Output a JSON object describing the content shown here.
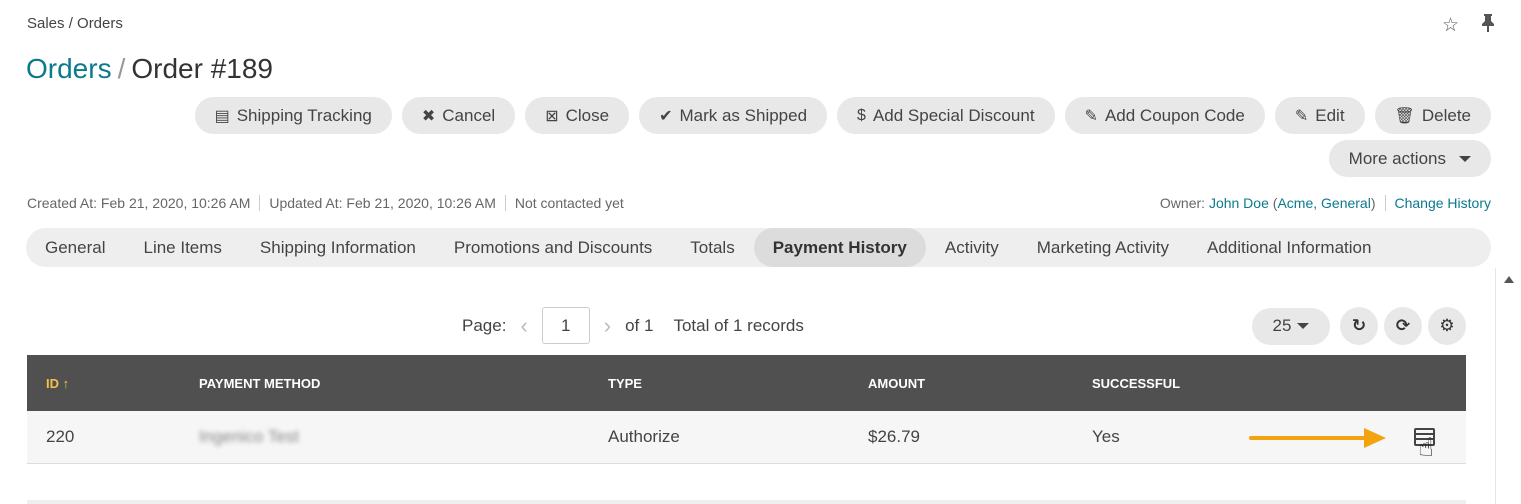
{
  "breadcrumb": "Sales / Orders",
  "top_icons": {
    "favorite_icon": "☆",
    "pin_icon": "📌"
  },
  "title": {
    "parent": "Orders",
    "separator": "/",
    "current": "Order #189"
  },
  "actions": [
    {
      "icon": "▤",
      "label": "Shipping Tracking"
    },
    {
      "icon": "✖",
      "label": "Cancel"
    },
    {
      "icon": "⊠",
      "label": "Close"
    },
    {
      "icon": "✔",
      "label": "Mark as Shipped"
    },
    {
      "icon": "$",
      "label": "Add Special Discount"
    },
    {
      "icon": "✎",
      "label": "Add Coupon Code"
    },
    {
      "icon": "✎",
      "label": "Edit"
    },
    {
      "icon": "🗑",
      "label": "Delete"
    }
  ],
  "more_actions": "More actions",
  "meta": {
    "created": "Created At: Feb 21, 2020, 10:26 AM",
    "updated": "Updated At: Feb 21, 2020, 10:26 AM",
    "contacted": "Not contacted yet"
  },
  "owner": {
    "label": "Owner:",
    "name": "John Doe",
    "paren_open": "(",
    "org": "Acme",
    "comma": ",",
    "bu": "General",
    "paren_close": ")",
    "change_history": "Change History"
  },
  "tabs": [
    "General",
    "Line Items",
    "Shipping Information",
    "Promotions and Discounts",
    "Totals",
    "Payment History",
    "Activity",
    "Marketing Activity",
    "Additional Information"
  ],
  "active_tab": "Payment History",
  "pager": {
    "label": "Page:",
    "current": "1",
    "of": "of 1",
    "total": "Total of 1 records",
    "prev_icon": "‹",
    "next_icon": "›"
  },
  "per_page": "25",
  "tool_icons": {
    "refresh": "↻",
    "reset": "⟳",
    "settings": "⚙"
  },
  "table": {
    "headers": {
      "id": "ID",
      "sort_icon": "↑",
      "payment_method": "PAYMENT METHOD",
      "type": "TYPE",
      "amount": "AMOUNT",
      "successful": "SUCCESSFUL"
    },
    "rows": [
      {
        "id": "220",
        "payment_method": "Ingenico Test",
        "type": "Authorize",
        "amount": "$26.79",
        "successful": "Yes"
      }
    ]
  },
  "cursor_icon": "☝",
  "colors": {
    "link": "#0b7a8f",
    "header_bg": "#505050",
    "sorted_header": "#f2c24a",
    "annotation_arrow": "#f2a30f"
  }
}
